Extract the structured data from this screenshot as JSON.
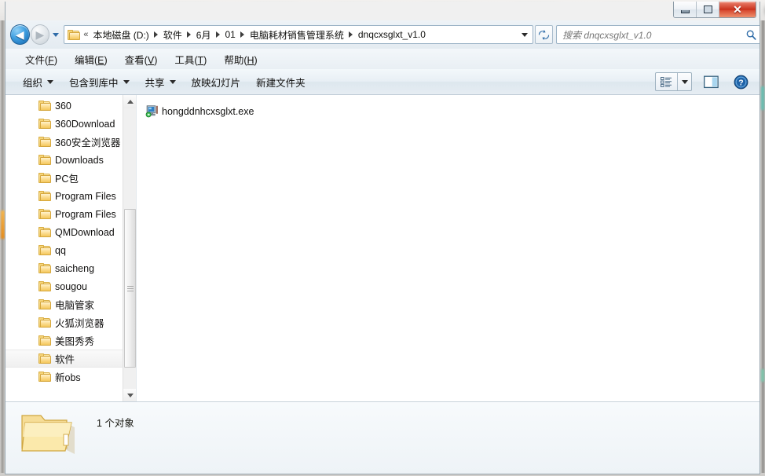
{
  "window": {
    "caption_buttons": [
      {
        "name": "minimize",
        "tooltip": "最小化"
      },
      {
        "name": "maximize",
        "tooltip": "最大化"
      },
      {
        "name": "close",
        "glyph": "✕",
        "tooltip": "关闭"
      }
    ]
  },
  "address_bar": {
    "back_arrow": "◀",
    "forward_arrow": "▶",
    "chevrons": "«",
    "breadcrumbs": [
      "本地磁盘 (D:)",
      "软件",
      "6月",
      "01",
      "电脑耗材销售管理系统",
      "dnqcxsglxt_v1.0"
    ],
    "refresh_label": "↻"
  },
  "search": {
    "placeholder": "搜索 dnqcxsglxt_v1.0",
    "value": ""
  },
  "menubar": {
    "items": [
      {
        "text": "文件",
        "key": "F"
      },
      {
        "text": "编辑",
        "key": "E"
      },
      {
        "text": "查看",
        "key": "V"
      },
      {
        "text": "工具",
        "key": "T"
      },
      {
        "text": "帮助",
        "key": "H"
      }
    ]
  },
  "toolbar": {
    "items": [
      {
        "label": "组织",
        "has_dropdown": true
      },
      {
        "label": "包含到库中",
        "has_dropdown": true
      },
      {
        "label": "共享",
        "has_dropdown": true
      },
      {
        "label": "放映幻灯片",
        "has_dropdown": false
      },
      {
        "label": "新建文件夹",
        "has_dropdown": false
      }
    ],
    "view_button": "change-view-button",
    "preview_button": "preview-pane-button",
    "help_button": "help-button"
  },
  "nav_pane": {
    "selected": "软件",
    "items": [
      {
        "label": "360"
      },
      {
        "label": "360Download"
      },
      {
        "label": "360安全浏览器"
      },
      {
        "label": "Downloads"
      },
      {
        "label": "PC包"
      },
      {
        "label": "Program Files"
      },
      {
        "label": "Program Files"
      },
      {
        "label": "QMDownload"
      },
      {
        "label": "qq"
      },
      {
        "label": "saicheng"
      },
      {
        "label": "sougou"
      },
      {
        "label": "电脑管家"
      },
      {
        "label": "火狐浏览器"
      },
      {
        "label": "美图秀秀"
      },
      {
        "label": "软件"
      },
      {
        "label": "新obs"
      }
    ]
  },
  "file_list": {
    "items": [
      {
        "name": "hongddnhcxsglxt.exe",
        "icon": "setup-exe-icon"
      }
    ]
  },
  "details_pane": {
    "item_count_text": "1 个对象",
    "icon": "folder-large-icon"
  },
  "colors": {
    "accent_blue": "#2f6ca8",
    "close_red": "#c8301b",
    "folder_yellow": "#f3ce6a",
    "window_chrome": "#e9eff4"
  }
}
